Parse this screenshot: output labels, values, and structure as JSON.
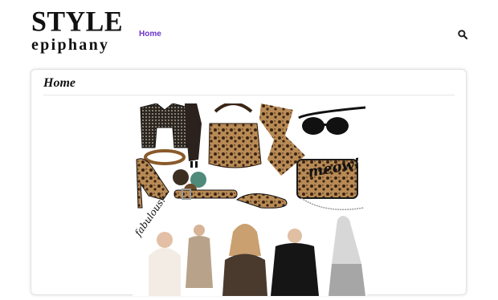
{
  "header": {
    "logo_top": "STYLE",
    "logo_bottom": "epiphany",
    "nav": {
      "home_label": "Home"
    }
  },
  "icons": {
    "search": "search-icon"
  },
  "colors": {
    "nav_accent": "#6b34c9"
  },
  "main": {
    "page_title": "Home",
    "collage": {
      "caption_meow": "meow!",
      "caption_fabulous": "fabulous!"
    }
  }
}
